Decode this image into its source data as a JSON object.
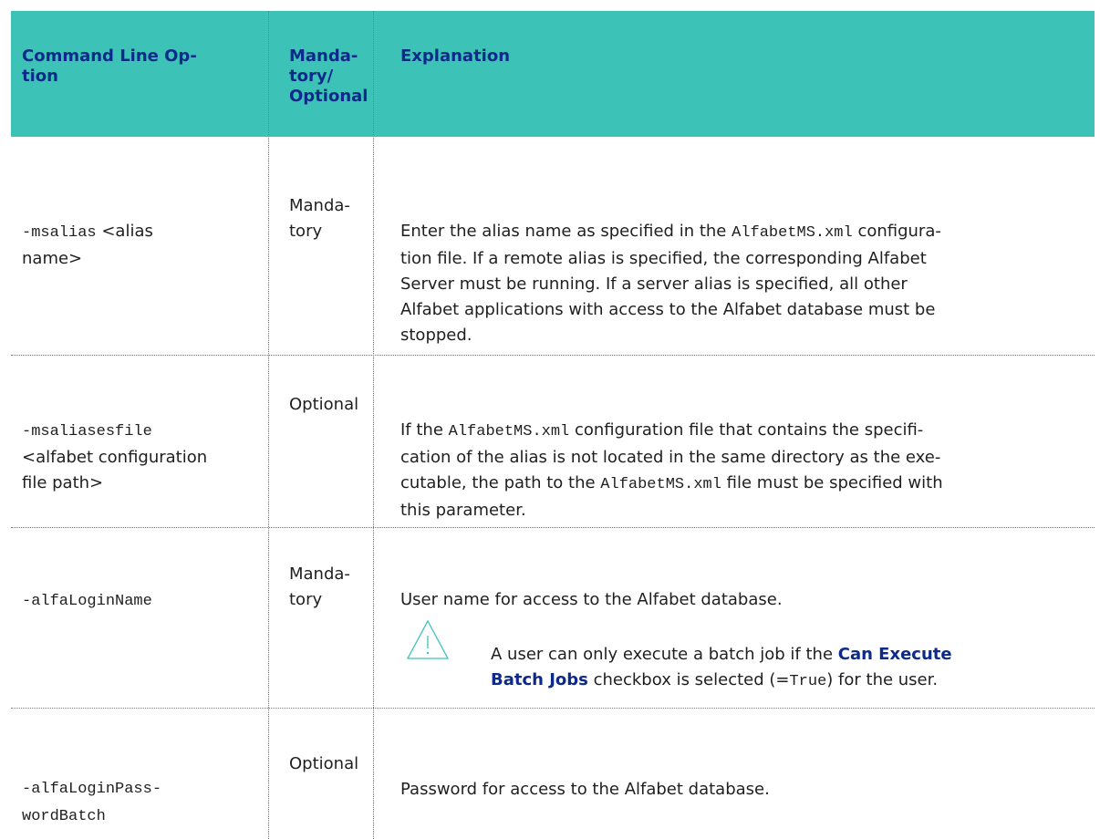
{
  "header": {
    "col1": "Command Line Op-\ntion",
    "col2": "Manda-\ntory/\nOptional",
    "col3": "Explanation"
  },
  "rows": [
    {
      "opt_code": "-msalias",
      "opt_text": " <alias\nname>",
      "req": "Manda-\ntory",
      "exp": [
        {
          "t": "Enter the alias name as specified in the "
        },
        {
          "c": "AlfabetMS.xml"
        },
        {
          "t": " configura-\ntion file. If a remote alias is specified, the corresponding Alfabet\nServer must be running. If a server alias is specified, all other\nAlfabet applications with access to the Alfabet database must be\nstopped."
        }
      ]
    },
    {
      "opt_code": "-msaliasesfile",
      "opt_text": "\n<alfabet configuration\nfile path>",
      "req": "Optional",
      "exp": [
        {
          "t": "If the "
        },
        {
          "c": "AlfabetMS.xml"
        },
        {
          "t": " configuration file that contains the specifi-\ncation of the alias is not located in the same directory as the exe-\ncutable, the path to the "
        },
        {
          "c": "AlfabetMS.xml"
        },
        {
          "t": " file must be specified with\nthis parameter."
        }
      ]
    },
    {
      "opt_code": "-alfaLoginName",
      "req": "Manda-\ntory",
      "exp": [
        {
          "t": "User name for access to the Alfabet database."
        }
      ],
      "note": {
        "icon": "warning-triangle-icon",
        "p1": "A user can only execute a batch job if the ",
        "b1": "Can Execute\nBatch Jobs",
        "p2": " checkbox is selected (=",
        "code": "True",
        "p3": ") for the user."
      }
    },
    {
      "opt_code": "-alfaLoginPass-\nwordBatch",
      "req": "Optional",
      "exp": [
        {
          "t": "Password for access to the Alfabet database."
        }
      ]
    }
  ]
}
